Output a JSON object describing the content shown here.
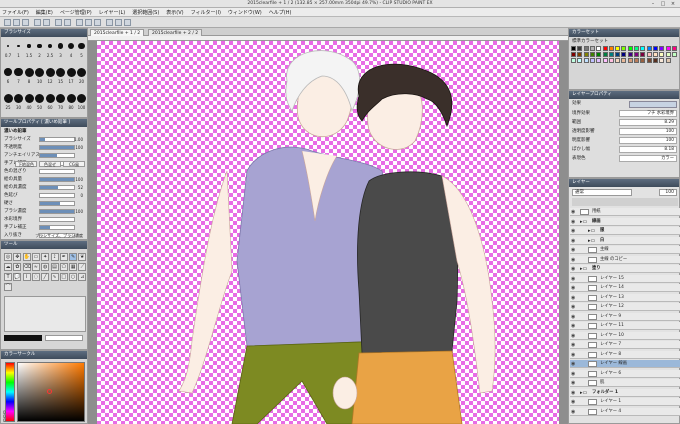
{
  "window": {
    "title": "2015clearfile + 1 / 2 (132.85 × 257.00mm 350dpi 49.7%) - CLIP STUDIO PAINT EX",
    "controls": [
      "–",
      "□",
      "×"
    ]
  },
  "menu": [
    "ファイル(F)",
    "編集(E)",
    "ページ管理(P)",
    "レイヤー(L)",
    "選択範囲(S)",
    "表示(V)",
    "フィルター(I)",
    "ウィンドウ(W)",
    "ヘルプ(H)"
  ],
  "documents": {
    "tabs": [
      "2015clearfile + 1 / 2",
      "2015clearfile + 2 / 2"
    ]
  },
  "brush_size_panel": {
    "title": "ブラシサイズ",
    "sizes": [
      "0.7",
      "1",
      "1.5",
      "2",
      "2.5",
      "3",
      "4",
      "5",
      "6",
      "7",
      "8",
      "10",
      "12",
      "15",
      "17",
      "20",
      "25",
      "30",
      "40",
      "50",
      "60",
      "70",
      "80",
      "100"
    ]
  },
  "tool_property": {
    "title": "ツールプロパティ [ 濃いめ鉛筆 ]",
    "tool_name": "濃いめ鉛筆",
    "rows": [
      {
        "label": "ブラシサイズ",
        "value": "1.00",
        "fill": 0.15
      },
      {
        "label": "不透明度",
        "value": "100",
        "fill": 1.0
      },
      {
        "label": "アンチエイリアス",
        "value": "",
        "fill": 0.5
      },
      {
        "label": "手ブレ補正",
        "value": "7",
        "fill": 0.07
      },
      {
        "label": "色の混ざり",
        "value": "",
        "fill": 0.0
      },
      {
        "label": "絵の具量",
        "value": "100",
        "fill": 1.0
      },
      {
        "label": "絵の具濃度",
        "value": "52",
        "fill": 0.52
      },
      {
        "label": "色延び",
        "value": "0",
        "fill": 0.0
      },
      {
        "label": "硬さ",
        "value": "",
        "fill": 0.6
      },
      {
        "label": "ブラシ濃度",
        "value": "100",
        "fill": 1.0
      },
      {
        "label": "水彩境界",
        "value": "",
        "fill": 0.0
      },
      {
        "label": "手ブレ補正",
        "value": "",
        "fill": 0.3
      },
      {
        "label": "入り抜き",
        "value": "ブラシサイズ、ブラシ濃度",
        "fill": 0.0
      }
    ],
    "blend_options": [
      "下地混色",
      "色混ぜ",
      "CG風"
    ]
  },
  "tool_panel": {
    "title": "ツール",
    "tools": [
      "zoom-icon",
      "move-icon",
      "operation-icon",
      "select-icon",
      "wand-icon",
      "eyedropper-icon",
      "pen-icon",
      "pencil-icon",
      "brush-icon",
      "airbrush-icon",
      "deco-icon",
      "eraser-icon",
      "blend-icon",
      "fill-icon",
      "gradient-icon",
      "figure-icon",
      "frame-icon",
      "ruler-icon",
      "text-icon",
      "balloon-icon",
      "correct-line-icon",
      "lasso-icon",
      "line-icon",
      "curve-icon",
      "rect-icon",
      "ellipse-icon",
      "polyline-icon",
      "spline-icon"
    ]
  },
  "color_circle": {
    "title": "カラーサークル",
    "hsv": [
      "0",
      "0",
      "0"
    ]
  },
  "color_set": {
    "title": "カラーセット",
    "set_name": "標準カラーセット",
    "swatches": [
      "#000000",
      "#3c3c3c",
      "#787878",
      "#b4b4b4",
      "#ffffff",
      "#ff0000",
      "#ff8000",
      "#ffff00",
      "#80ff00",
      "#00ff00",
      "#00ff80",
      "#00ffff",
      "#0080ff",
      "#0000ff",
      "#8000ff",
      "#ff00ff",
      "#ff0080",
      "#800000",
      "#804000",
      "#808000",
      "#408000",
      "#008000",
      "#008040",
      "#008080",
      "#004080",
      "#000080",
      "#400080",
      "#800080",
      "#800040",
      "#ffc0c0",
      "#ffe0c0",
      "#ffffc0",
      "#e0ffc0",
      "#c0ffc0",
      "#c0ffe0",
      "#c0ffff",
      "#c0e0ff",
      "#c0c0ff",
      "#e0c0ff",
      "#ffc0ff",
      "#ffc0e0",
      "#f4d7c0",
      "#e8b898",
      "#d49a78",
      "#b87a58",
      "#986040",
      "#784830",
      "#583020",
      "#f8e8d8",
      "#e0c8b0"
    ]
  },
  "layer_property": {
    "title": "レイヤープロパティ",
    "effect": "効果",
    "rows": [
      {
        "label": "境界効果",
        "value": "フチ  水彩境界"
      },
      {
        "label": "範囲",
        "value": "8.29"
      },
      {
        "label": "透明度影響",
        "value": "100"
      },
      {
        "label": "明度影響",
        "value": "100"
      },
      {
        "label": "ぼかし幅",
        "value": "8.18"
      },
      {
        "label": "表現色",
        "value": "カラー"
      }
    ]
  },
  "layer_panel": {
    "title": "レイヤー",
    "blend_mode": "通常",
    "opacity": "100",
    "layers": [
      {
        "name": "用紙",
        "type": "paper",
        "indent": 0
      },
      {
        "name": "線画",
        "type": "folder",
        "indent": 0
      },
      {
        "name": "服",
        "type": "folder",
        "indent": 1
      },
      {
        "name": "白",
        "type": "folder",
        "indent": 1
      },
      {
        "name": "主線",
        "type": "layer",
        "indent": 1
      },
      {
        "name": "主線 のコピー",
        "type": "layer",
        "indent": 1
      },
      {
        "name": "塗り",
        "type": "folder",
        "indent": 0
      },
      {
        "name": "レイヤー 15",
        "type": "layer",
        "indent": 1
      },
      {
        "name": "レイヤー 14",
        "type": "layer",
        "indent": 1
      },
      {
        "name": "レイヤー 13",
        "type": "layer",
        "indent": 1
      },
      {
        "name": "レイヤー 12",
        "type": "layer",
        "indent": 1
      },
      {
        "name": "レイヤー 9",
        "type": "layer",
        "indent": 1
      },
      {
        "name": "レイヤー 11",
        "type": "layer",
        "indent": 1
      },
      {
        "name": "レイヤー 10",
        "type": "layer",
        "indent": 1
      },
      {
        "name": "レイヤー 7",
        "type": "layer",
        "indent": 1
      },
      {
        "name": "レイヤー 8",
        "type": "layer",
        "indent": 1
      },
      {
        "name": "レイヤー 線画",
        "type": "layer",
        "indent": 1,
        "selected": true
      },
      {
        "name": "レイヤー 6",
        "type": "layer",
        "indent": 1
      },
      {
        "name": "肌",
        "type": "layer",
        "indent": 1
      },
      {
        "name": "フォルダー 1",
        "type": "folder",
        "indent": 0
      },
      {
        "name": "レイヤー 1",
        "type": "layer",
        "indent": 1
      },
      {
        "name": "レイヤー 4",
        "type": "layer",
        "indent": 1
      }
    ]
  }
}
